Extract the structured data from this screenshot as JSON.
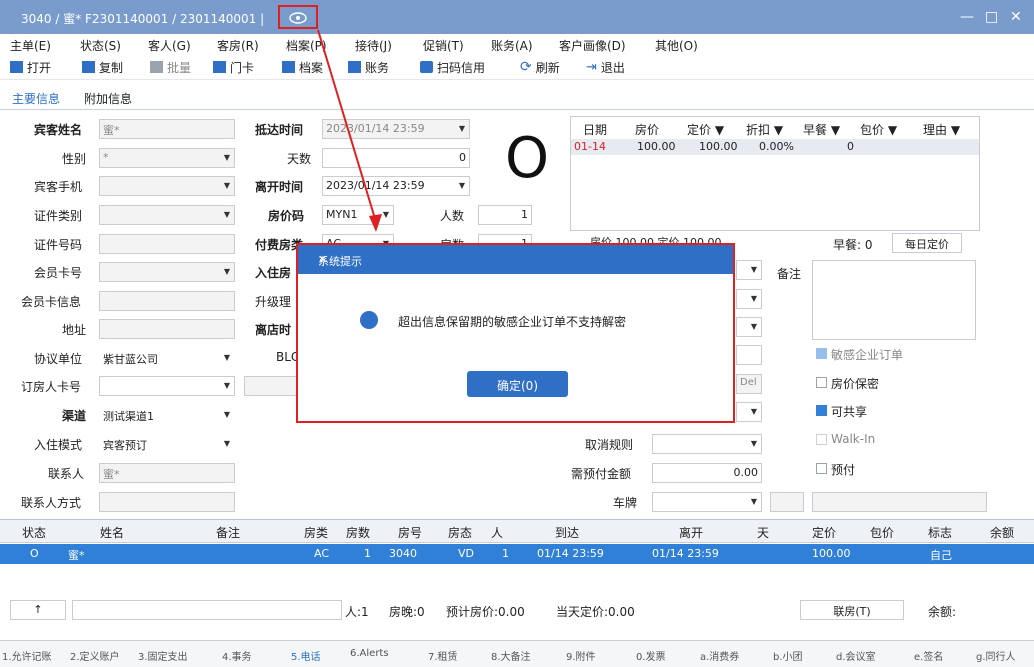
{
  "window": {
    "title": "3040 / 蜜* F2301140001 / 2301140001 |",
    "minimize": "—",
    "maximize": "□",
    "close": "✕"
  },
  "menu": [
    "主单(E)",
    "状态(S)",
    "客人(G)",
    "客房(R)",
    "档案(P)",
    "接待(J)",
    "促销(T)",
    "账务(A)",
    "客户画像(D)",
    "其他(O)"
  ],
  "toolbar": [
    "打开",
    "复制",
    "批量",
    "门卡",
    "档案",
    "账务",
    "扫码信用",
    "刷新",
    "退出"
  ],
  "tabs": [
    "主要信息",
    "附加信息"
  ],
  "left": {
    "guest_name_label": "宾客姓名",
    "guest_name": "蜜*",
    "gender_label": "性别",
    "gender": "*",
    "phone_label": "宾客手机",
    "id_type_label": "证件类别",
    "id_no_label": "证件号码",
    "member_card_label": "会员卡号",
    "member_info_label": "会员卡信息",
    "address_label": "地址",
    "agreement_label": "协议单位",
    "agreement": "紫甘蓝公司",
    "booker_card_label": "订房人卡号",
    "channel_label": "渠道",
    "channel": "测试渠道1",
    "checkin_mode_label": "入住模式",
    "checkin_mode": "宾客预订",
    "contact_label": "联系人",
    "contact": "蜜*",
    "contact_method_label": "联系人方式"
  },
  "middle": {
    "arrive_label": "抵达时间",
    "arrive": "2023/01/14 23:59",
    "days_label": "天数",
    "days": "0",
    "depart_label": "离开时间",
    "depart": "2023/01/14 23:59",
    "rate_code_label": "房价码",
    "rate_code": "MYN1",
    "people_label": "人数",
    "people": "1",
    "pay_room_label": "付费房类",
    "pay_room": "AC",
    "rooms_label": "房数",
    "rooms": "1",
    "checkin_room_label": "入住房",
    "upgrade_label": "升级理",
    "depart_time_label": "离店时",
    "blc_label": "BLC",
    "big_status": "O"
  },
  "rate_grid": {
    "headers": [
      "日期",
      "房价",
      "定价 ▼",
      "折扣 ▼",
      "早餐 ▼",
      "包价 ▼",
      "理由 ▼"
    ],
    "row": [
      "01-14",
      "100.00",
      "100.00",
      "0.00%",
      "0",
      "",
      ""
    ],
    "summary": {
      "room_price_label": "房价",
      "room_price": "100.00",
      "set_price_label": "定价",
      "set_price": "100.00",
      "breakfast": "早餐: 0",
      "daily_btn": "每日定价"
    }
  },
  "right": {
    "remark_label": "备注",
    "cancel_rule_label": "取消规则",
    "prepay_label": "需预付金额",
    "prepay": "0.00",
    "plate_label": "车牌",
    "sensitive": "敏感企业订单",
    "rate_secret": "房价保密",
    "shareable": "可共享",
    "walkin": "Walk-In",
    "prepaid": "预付",
    "del_btn": "Del"
  },
  "guest_table": {
    "headers": [
      "状态",
      "姓名",
      "备注",
      "房类",
      "房数",
      "房号",
      "房态",
      "人",
      "到达",
      "离开",
      "天",
      "定价",
      "包价",
      "标志",
      "余额"
    ],
    "row": [
      "O",
      "蜜*",
      "",
      "AC",
      "1",
      "3040",
      "VD",
      "1",
      "01/14 23:59",
      "01/14 23:59",
      "",
      "100.00",
      "",
      "自己",
      ""
    ]
  },
  "status_bar": {
    "up": "↑",
    "people": "人:1",
    "room_nights": "房晚:0",
    "est_price": "预计房价:0.00",
    "today_price": "当天定价:0.00",
    "link_btn": "联房(T)",
    "balance": "余额:"
  },
  "bottom_tabs": [
    "1.允许记账",
    "2.定义账户",
    "3.固定支出",
    "4.事务",
    "5.电话",
    "6.Alerts",
    "7.租赁",
    "8.大备注",
    "9.附件",
    "0.发票",
    "a.消费券",
    "b.小团",
    "d.会议室",
    "e.签名",
    "g.同行人"
  ],
  "dialog": {
    "title": "系统提示",
    "close": "✕",
    "message": "超出信息保留期的敏感企业订单不支持解密",
    "ok": "确定(0)"
  },
  "colors": {
    "titlebar": "#7a9ccc",
    "accent": "#2f6fc6",
    "highlight": "#e02020"
  }
}
